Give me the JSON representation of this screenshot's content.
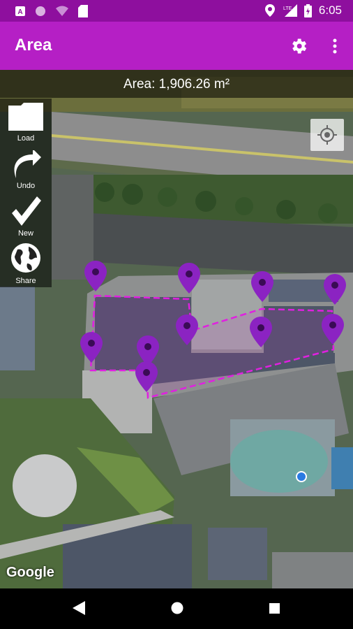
{
  "status": {
    "time": "6:05",
    "left_icons": [
      "a-icon",
      "circle-icon",
      "wifi-icon",
      "sim-icon"
    ],
    "right_icons": [
      "location-icon",
      "lte-signal-icon",
      "battery-icon"
    ]
  },
  "appbar": {
    "title": "Area",
    "settings_icon": "gear-icon",
    "menu_icon": "more-vert-icon"
  },
  "area_text": "Area: 1,906.26 m²",
  "tools": [
    {
      "label": "Load",
      "icon": "folder-icon"
    },
    {
      "label": "Undo",
      "icon": "undo-icon"
    },
    {
      "label": "New",
      "icon": "check-icon"
    },
    {
      "label": "Share",
      "icon": "globe-icon"
    }
  ],
  "map": {
    "attribution": "Google",
    "marker_color": "#8b23c2",
    "polygon_color": "#d21cd2",
    "marker_count": 11
  },
  "nav": {
    "icons": [
      "back-icon",
      "home-icon",
      "recent-apps-icon"
    ]
  },
  "colors": {
    "statusbar": "#8e0f9e",
    "appbar": "#b51fc5"
  }
}
